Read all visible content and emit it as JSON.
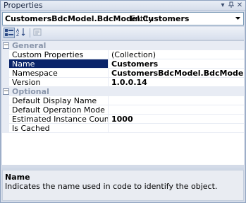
{
  "window": {
    "title": "Properties"
  },
  "object_selector": {
    "name": "CustomersBdcModel.BdcModel.Customers",
    "type": "Entity"
  },
  "toolbar": {
    "categorized_icon": "categorized-icon",
    "alphabetical_icon": "alphabetical-icon",
    "property_pages_icon": "property-pages-icon"
  },
  "categories": [
    {
      "label": "General",
      "expanded": true
    },
    {
      "label": "Optional",
      "expanded": true
    }
  ],
  "general": [
    {
      "name": "Custom Properties",
      "value": "(Collection)"
    },
    {
      "name": "Name",
      "value": "Customers"
    },
    {
      "name": "Namespace",
      "value": "CustomersBdcModel.BdcModel"
    },
    {
      "name": "Version",
      "value": "1.0.0.14"
    }
  ],
  "optional": [
    {
      "name": "Default Display Name",
      "value": ""
    },
    {
      "name": "Default Operation Mode",
      "value": ""
    },
    {
      "name": "Estimated Instance Count",
      "value": "1000"
    },
    {
      "name": "Is Cached",
      "value": ""
    }
  ],
  "description": {
    "title": "Name",
    "text": "Indicates the name used in code to identify the object."
  },
  "colors": {
    "selection": "#0a246a",
    "category_text": "#8a96ab"
  }
}
